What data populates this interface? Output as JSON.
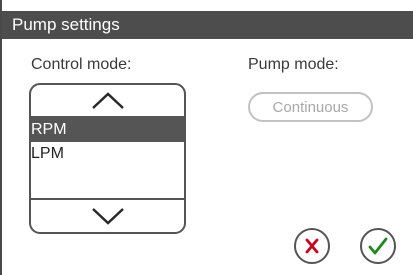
{
  "title": "Pump settings",
  "control_mode": {
    "label": "Control mode:",
    "options": [
      "RPM",
      "LPM"
    ],
    "selected": "RPM"
  },
  "pump_mode": {
    "label": "Pump mode:",
    "value": "Continuous",
    "enabled": false
  },
  "icons": {
    "scroll_up": "chevron-up-icon",
    "scroll_down": "chevron-down-icon",
    "cancel": "red-x-icon",
    "confirm": "green-checkmark-icon"
  },
  "colors": {
    "titlebar": "#4d4d4d",
    "selected_row": "#555555",
    "cancel": "#d0021b",
    "confirm": "#1e8a1e",
    "disabled": "#a8a8a8"
  }
}
